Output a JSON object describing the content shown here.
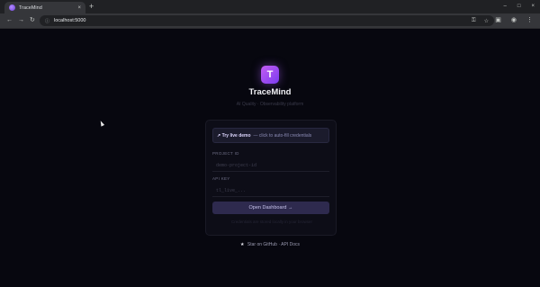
{
  "browser": {
    "tab_title": "TraceMind",
    "tab_close": "×",
    "new_tab": "+",
    "url": "localhost:5000",
    "window_controls": {
      "minimize": "–",
      "maximize": "□",
      "close": "×"
    },
    "nav": {
      "back": "←",
      "forward": "→",
      "reload": "↻"
    },
    "icons": [
      "key-icon",
      "star-icon",
      "tab-search-icon",
      "profile-icon",
      "menu-icon"
    ]
  },
  "app": {
    "logo_letter": "T",
    "name": "TraceMind",
    "tagline": "AI Quality · Observability platform"
  },
  "login": {
    "demo_strong": "↗ Try live demo",
    "demo_rest": "— click to auto-fill credentials",
    "project_label": "PROJECT ID",
    "project_placeholder": "demo-project-id",
    "apikey_label": "API KEY",
    "apikey_placeholder": "tl_live_...",
    "button": "Open Dashboard →",
    "footnote": "Credentials are stored locally in your browser"
  },
  "footer": {
    "star": "★",
    "text": "Star on GitHub · API Docs"
  },
  "colors": {
    "background": "#07070f",
    "accent": "#7a3cf0",
    "button": "#2e2a4e"
  }
}
